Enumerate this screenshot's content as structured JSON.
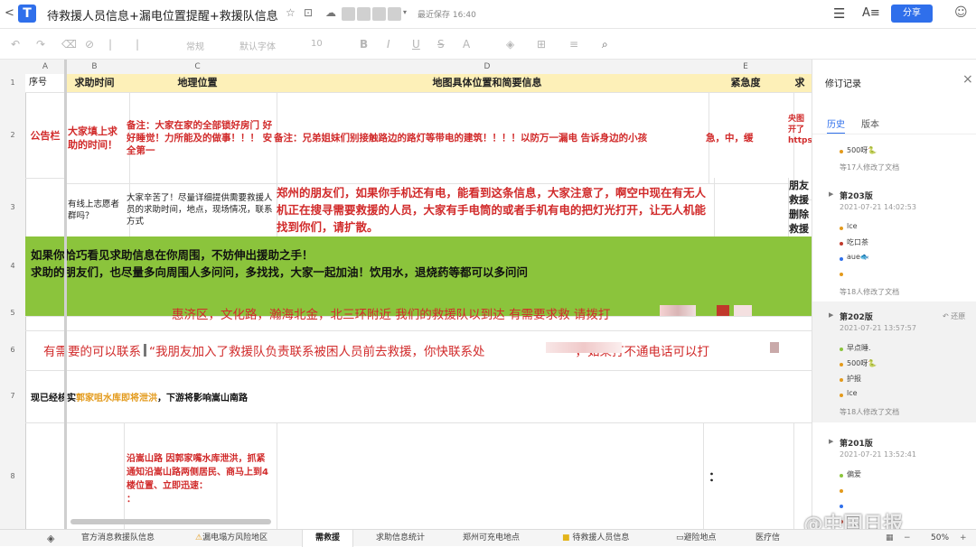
{
  "app": {
    "back": "<",
    "logo": "T",
    "doc_title": "待救援人员信息+漏电位置提醒+救援队信息",
    "saved_status": "最近保存 16:40",
    "share_label": "分享"
  },
  "toolbar": {
    "font_style": "常规",
    "font_family": "默认字体",
    "font_size": "10"
  },
  "columns": [
    "A",
    "B",
    "C",
    "D",
    "E"
  ],
  "rows": [
    "1",
    "2",
    "3",
    "4",
    "5",
    "6",
    "7",
    "8"
  ],
  "header_row": {
    "a": "序号",
    "b": "求助时间",
    "c": "地理位置",
    "d": "地图具体位置和简要信息",
    "e": "紧急度",
    "f": "求"
  },
  "row2": {
    "a": "公告栏",
    "b": "大家填上求助的时间！",
    "c": "备注：大家在家的全部锁好房门 好好睡觉！力所能及的做事！！！ 安全第一",
    "d": "备注：兄弟姐妹们别接触路边的路灯等带电的建筑！！！！以防万一漏电 告诉身边的小孩",
    "e": "急，中，缓",
    "f1": "央图",
    "f2": "开了",
    "f3": "https"
  },
  "row3": {
    "b": "有线上志愿者群吗？",
    "c": "大家辛苦了！尽量详细提供需要救援人员的求助时间，地点，现场情况，联系方式",
    "d": "郑州的朋友们，如果你手机还有电，能看到这条信息，大家注意了，啊空中现在有无人机正在搜寻需要救援的人员，大家有手电筒的或者手机有电的把灯光打开，让无人机能找到你们，请扩散。",
    "f": "朋友救援删除救援"
  },
  "row4": {
    "line1": "如果你恰巧看见求助信息在你周围，不妨伸出援助之手！",
    "line2": "求助的朋友们，也尽量多向周围人多问问，多找找，大家一起加油！饮用水，退烧药等都可以多问问"
  },
  "row5": {
    "text": "惠济区，文化路，瀚海北金，北三环附近 我们的救援队以到达 有需要求救 请拨打"
  },
  "row6": {
    "text1": "有需要的可以联系",
    "text2": "“我朋友加入了救援队负责联系被困人员前去救援，你快联系处",
    "text3": "，如果打不通电话可以打"
  },
  "row7": {
    "prefix": "现已经核实",
    "highlight": "郭家咀水库即将泄洪",
    "suffix": "，下游将影响嵩山南路"
  },
  "row8": {
    "c": "沿嵩山路 因郭家嘴水库泄洪，抓紧通知沿嵩山路两侧居民、商马上到4楼位置、立即迅速：\n：",
    "e": "："
  },
  "panel": {
    "title": "修订记录",
    "tab_history": "历史",
    "tab_version": "版本",
    "v0": {
      "items": [
        "500呀🐍"
      ],
      "more": "等17人修改了文档"
    },
    "v203": {
      "title": "第203版",
      "date": "2021-07-21 14:02:53",
      "items": [
        "lce",
        "吃口茶",
        "aue🐟",
        ""
      ],
      "more": "等18人修改了文档"
    },
    "v202": {
      "title": "第202版",
      "date": "2021-07-21 13:57:57",
      "restore": "还原",
      "items": [
        "早点睡.",
        "500呀🐍",
        "护报",
        "lce"
      ],
      "more": "等18人修改了文档"
    },
    "v201": {
      "title": "第201版",
      "date": "2021-07-21 13:52:41",
      "items": [
        "偏爱",
        "",
        "",
        ""
      ]
    }
  },
  "tabs": [
    "官方消息救援队信息",
    "漏电塌方风险地区",
    "需救援",
    "求助信息统计",
    "郑州可充电地点",
    "待救援人员信息",
    "避险地点",
    "医疗信"
  ],
  "zoom": "50%",
  "watermark": "@中国日报",
  "colors": {
    "accent": "#2f6feb",
    "header_fill": "#fdf0b8",
    "green_fill": "#8bc43c",
    "alert_red": "#d12a2a",
    "orange": "#e39a1b"
  }
}
